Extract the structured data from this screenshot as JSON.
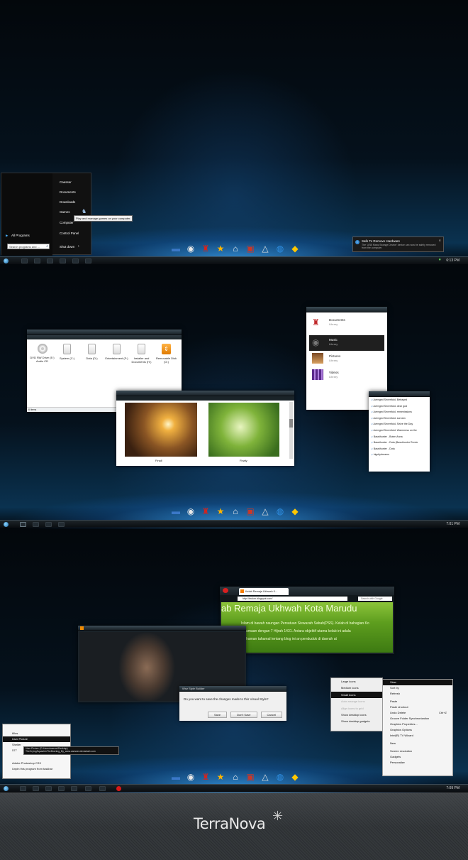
{
  "panel1": {
    "start_menu": {
      "right_items": [
        "Caesser",
        "Documents",
        "Downloads",
        "Games",
        "Computer",
        "Control Panel"
      ],
      "all_programs": "All Programs",
      "search_placeholder": "Search programs and ...",
      "shutdown": "Shut down",
      "tooltip": "Play and manage games on your computer."
    },
    "notification": {
      "title": "Safe To Remove Hardware",
      "body": "The 'USB Mass Storage Device' device can now be safely removed from the computer."
    },
    "clock": "6:13 PM"
  },
  "panel2": {
    "explorer": {
      "drives": [
        {
          "label": "DVD RW Drive (E:) Audio CD",
          "icon": "disc-icon"
        },
        {
          "label": "System (C:)",
          "icon": "drive-icon"
        },
        {
          "label": "Data (D:)",
          "icon": "drive-icon"
        },
        {
          "label": "Entertainment (F:)",
          "icon": "drive-icon"
        },
        {
          "label": "Installer and Documents (H:)",
          "icon": "drive-icon"
        },
        {
          "label": "Removable Disk (G:)",
          "icon": "usb-drive-icon"
        }
      ],
      "status": "6 items"
    },
    "photos": [
      {
        "caption": "Finall"
      },
      {
        "caption": "Finaly"
      }
    ],
    "libraries": [
      {
        "name": "Documents",
        "type": "Library"
      },
      {
        "name": "Music",
        "type": "Library"
      },
      {
        "name": "Pictures",
        "type": "Library"
      },
      {
        "name": "Videos",
        "type": "Library"
      }
    ],
    "songs": [
      "Avenged Sevenfold- Betrayed",
      "Avenged Sevenfold- dear god",
      "Avenged Sevenfold- remenissions",
      "Avenged Sevenfold- scream",
      "Avenged Sevenfold- Seize the Day",
      "Avenged Sevenfold- Warmness on the",
      "Bassthunter - Boten Anna",
      "Bassthunter - Dota (Bassthunter Remix",
      "Bassthunter - Dota",
      "bigcitydreams"
    ],
    "clock": "7:01 PM"
  },
  "panel3": {
    "browser": {
      "tab": "Kelab Remaja Ukhwah K...",
      "url": "http://brukm.blogspot.com/",
      "search_placeholder": "Search with Google",
      "heading": "ab Remaja Ukhwah Kota Marudu",
      "line1": "Islam di bawah naungan Persatuan Siswazah Sabah(PSS). Kelab di bahagian Ko",
      "line2": "mber 2009 bersamaan dengan 7 Hijrah 1431. Antara objektif utama kelab ini adala",
      "line3": "pe kembali kefahaman tahamal tentang blog ini an penduduk di daerah at"
    },
    "dialog": {
      "title": "Wnz Style Builder",
      "message": "Do you want to save the changes made to this Visual Style?",
      "save": "Save",
      "dont_save": "Don't Save",
      "cancel": "Cancel"
    },
    "view_submenu": [
      "Large icons",
      "Medium icons",
      "Small icons",
      "Auto arrange icons",
      "Align icons to grid",
      "Show desktop icons",
      "Show desktop gadgets"
    ],
    "context_menu": [
      "View",
      "Sort by",
      "Refresh",
      "Paste",
      "Paste shortcut",
      "Undo Delete",
      "Groove Folder Synchronization",
      "Graphics Properties...",
      "Graphics Options",
      "Intel(R) TV Wizard",
      "New",
      "Screen resolution",
      "Gadgets",
      "Personalize"
    ],
    "undo_shortcut": "Ctrl+Z",
    "jumplist": {
      "items": [
        "6llos",
        "User Picture",
        "Shelter",
        "577"
      ],
      "tooltip_line1": "User Picture (C:\\Users\\caesar\\Desktop)",
      "tooltip_line2": "TheCryingSquashInTheMorning_By_www.caesser.deviantart.com",
      "app": "Adobe Photoshop CS3",
      "unpin": "Unpin this program from taskbar"
    },
    "clock": "7:09 PM"
  },
  "branding": {
    "logo_text": "TerraNova"
  },
  "dock_icons": [
    "folder-icon",
    "cd-icon",
    "chair-icon",
    "star-icon",
    "home-icon",
    "easel-icon",
    "triangle-icon",
    "globe-icon",
    "warning-sign-icon"
  ],
  "colors": {
    "accent": "#2aa0ff",
    "taskbar": "#11171b",
    "highlight": "#1f1f1f"
  }
}
